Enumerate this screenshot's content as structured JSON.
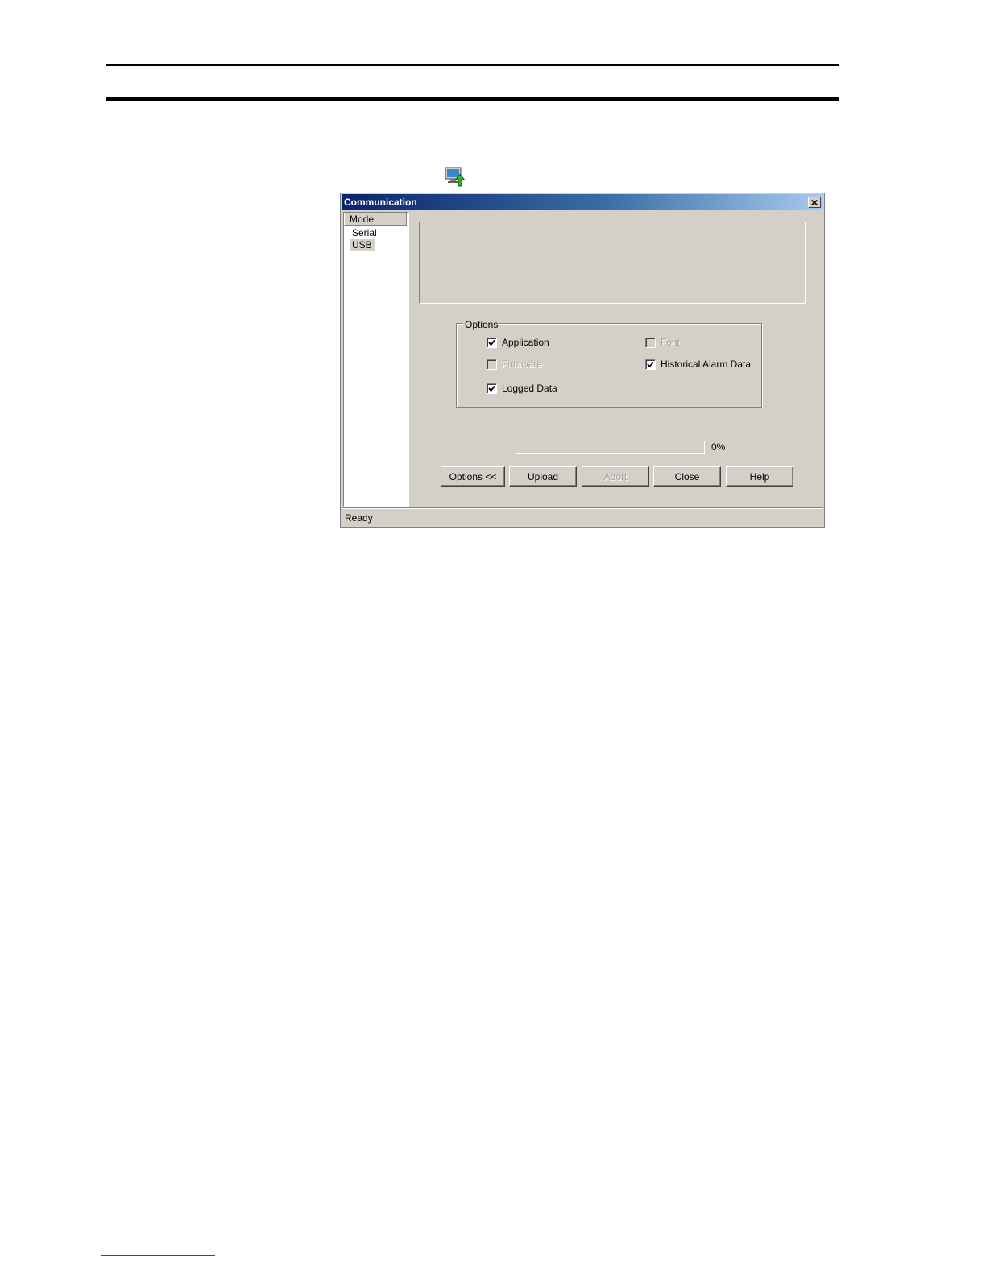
{
  "dialog": {
    "title": "Communication",
    "mode_panel": {
      "header": "Mode",
      "items": [
        {
          "label": "Serial",
          "selected": false
        },
        {
          "label": "USB",
          "selected": true
        }
      ]
    },
    "options": {
      "legend": "Options",
      "items": [
        {
          "label": "Application",
          "checked": true,
          "enabled": true
        },
        {
          "label": "Font",
          "checked": false,
          "enabled": false
        },
        {
          "label": "Firmware",
          "checked": false,
          "enabled": false
        },
        {
          "label": "Historical Alarm Data",
          "checked": true,
          "enabled": true
        },
        {
          "label": "Logged Data",
          "checked": true,
          "enabled": true
        }
      ]
    },
    "progress": {
      "value": 0,
      "label": "0%"
    },
    "buttons": {
      "options": "Options <<",
      "upload": "Upload",
      "abort": "Abort",
      "close": "Close",
      "help": "Help"
    },
    "status": "Ready"
  },
  "icons": {
    "toolbar": "upload-icon",
    "close": "close-icon",
    "check": "checkmark-icon"
  },
  "colors": {
    "title_gradient_start": "#0a246a",
    "title_gradient_end": "#a6caf0",
    "dialog_face": "#d4d0c8"
  }
}
